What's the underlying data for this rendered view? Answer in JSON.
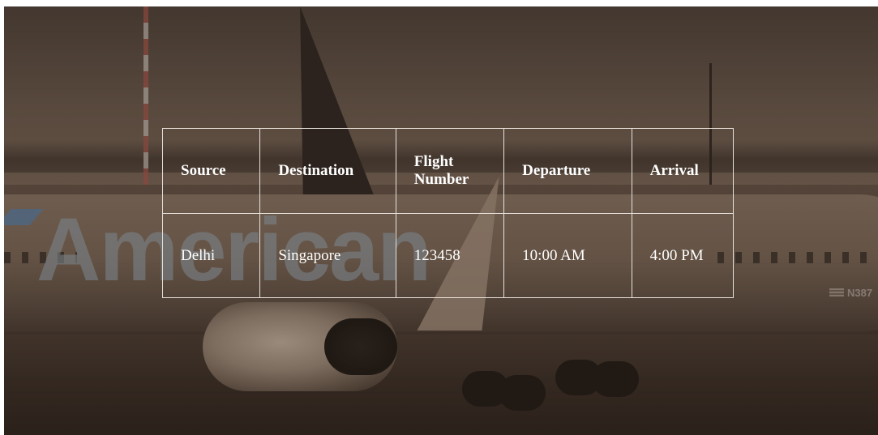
{
  "background": {
    "livery_text": "American",
    "tail_number": "N387",
    "overlay_color": "#281a10"
  },
  "table": {
    "headers": [
      "Source",
      "Destination",
      "Flight Number",
      "Departure",
      "Arrival"
    ],
    "rows": [
      [
        "Delhi",
        "Singapore",
        "123458",
        "10:00 AM",
        "4:00 PM"
      ]
    ],
    "text_color": "#ffffff",
    "border_color": "#e8e2dc"
  }
}
